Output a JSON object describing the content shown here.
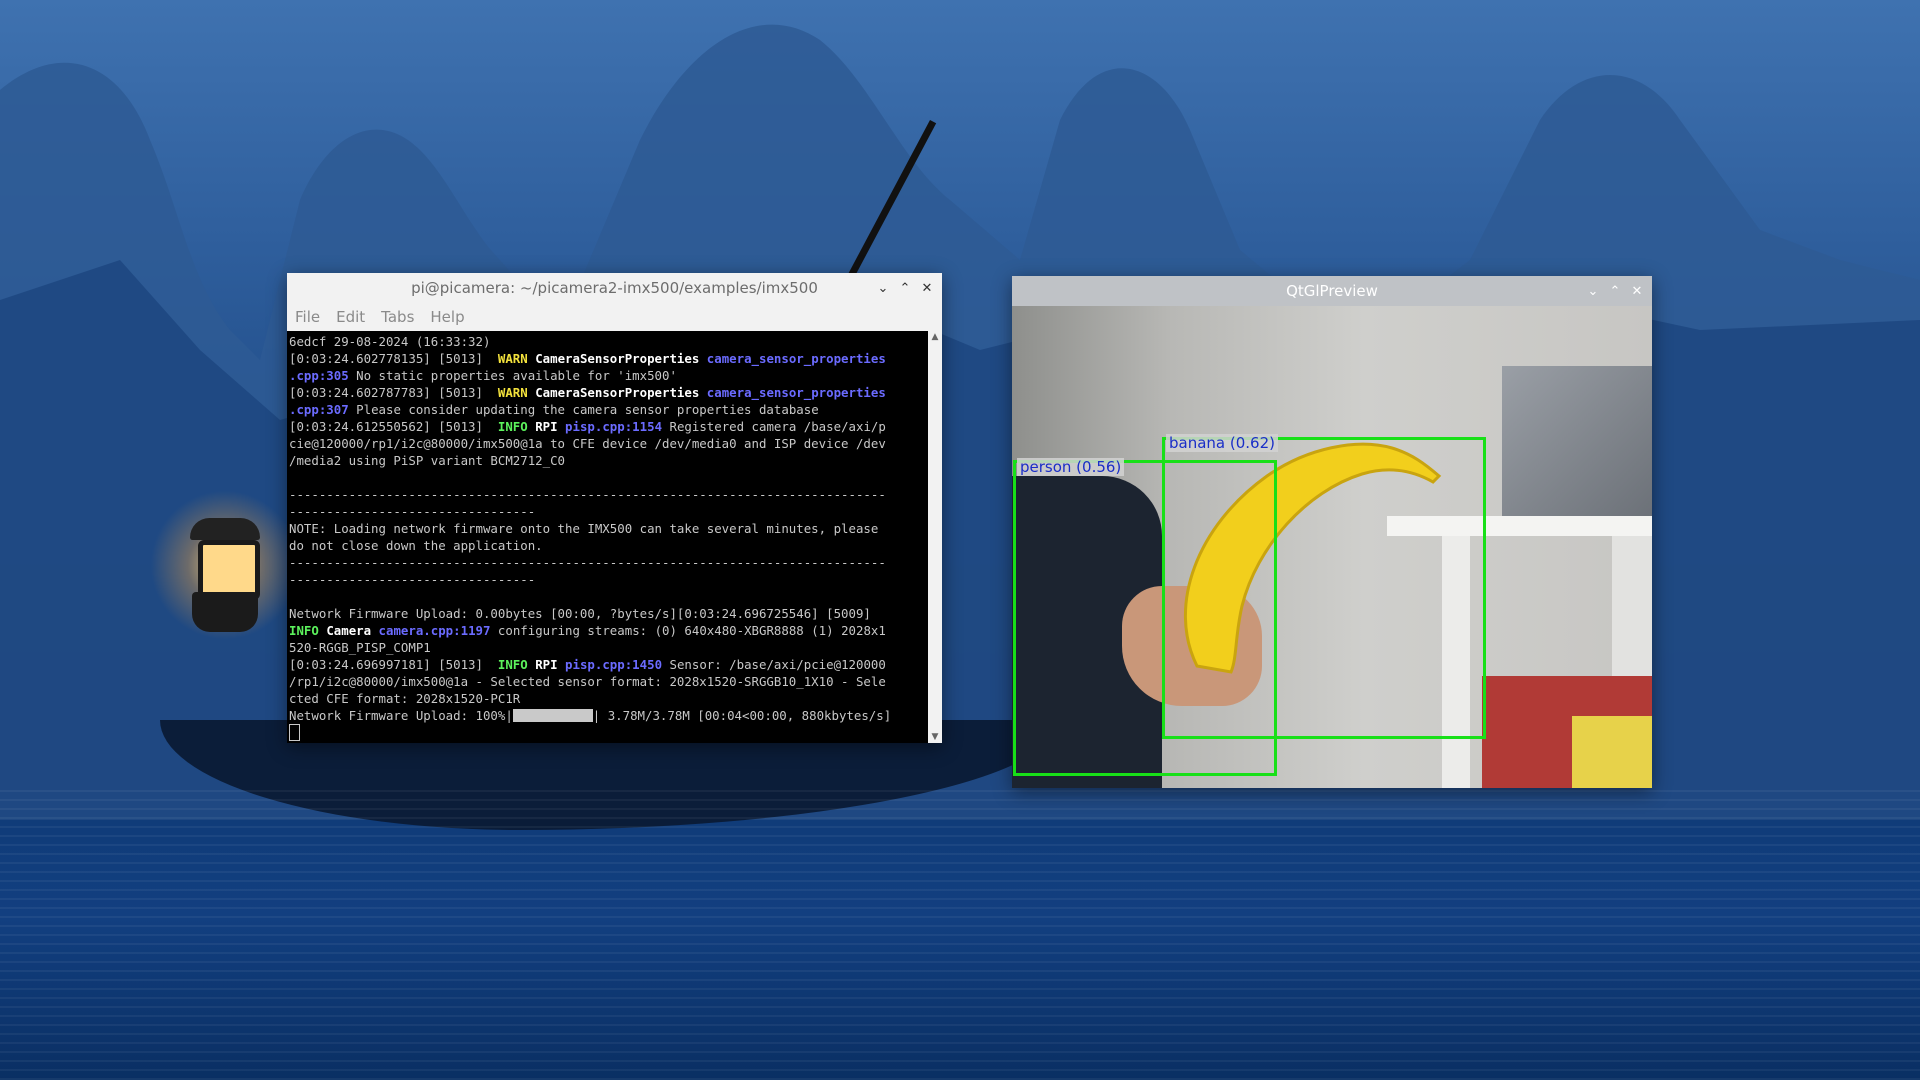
{
  "desktop": {
    "wallpaper": "lake-mountains-lantern-boat"
  },
  "terminal": {
    "title": "pi@picamera: ~/picamera2-imx500/examples/imx500",
    "menu": [
      "File",
      "Edit",
      "Tabs",
      "Help"
    ],
    "lines": [
      "6edcf 29-08-2024 (16:33:32)",
      "[0:03:24.602778135] [5013]  WARN CameraSensorProperties camera_sensor_properties",
      ".cpp:305 No static properties available for 'imx500'",
      "[0:03:24.602787783] [5013]  WARN CameraSensorProperties camera_sensor_properties",
      ".cpp:307 Please consider updating the camera sensor properties database",
      "[0:03:24.612550562] [5013]  INFO RPI pisp.cpp:1154 Registered camera /base/axi/p",
      "cie@120000/rp1/i2c@80000/imx500@1a to CFE device /dev/media0 and ISP device /dev",
      "/media2 using PiSP variant BCM2712_C0",
      "",
      "--------------------------------------------------------------------------------",
      "---------------------------------",
      "NOTE: Loading network firmware onto the IMX500 can take several minutes, please",
      "do not close down the application.",
      "--------------------------------------------------------------------------------",
      "---------------------------------",
      "",
      "Network Firmware Upload: 0.00bytes [00:00, ?bytes/s][0:03:24.696725546] [5009]",
      "INFO Camera camera.cpp:1197 configuring streams: (0) 640x480-XBGR8888 (1) 2028x1",
      "520-RGGB_PISP_COMP1",
      "[0:03:24.696997181] [5013]  INFO RPI pisp.cpp:1450 Sensor: /base/axi/pcie@120000",
      "/rp1/i2c@80000/imx500@1a - Selected sensor format: 2028x1520-SRGGB10_1X10 - Sele",
      "cted CFE format: 2028x1520-PC1R",
      "Network Firmware Upload: 100%|          | 3.78M/3.78M [00:04<00:00, 880kbytes/s]"
    ],
    "tokens": {
      "warn": "WARN",
      "info": "INFO",
      "camera_sensor_properties": "CameraSensorProperties",
      "rpi": "RPI",
      "camera": "Camera"
    }
  },
  "preview": {
    "title": "QtGlPreview",
    "detections": [
      {
        "label": "person (0.56)",
        "class": "person",
        "score": 0.56
      },
      {
        "label": "banana (0.62)",
        "class": "banana",
        "score": 0.62
      }
    ]
  },
  "colors": {
    "warn": "#f3e23c",
    "info": "#5cf25c",
    "link": "#6b6bff",
    "bbox": "#18e018",
    "bbox_label": "#1a2ec8"
  }
}
